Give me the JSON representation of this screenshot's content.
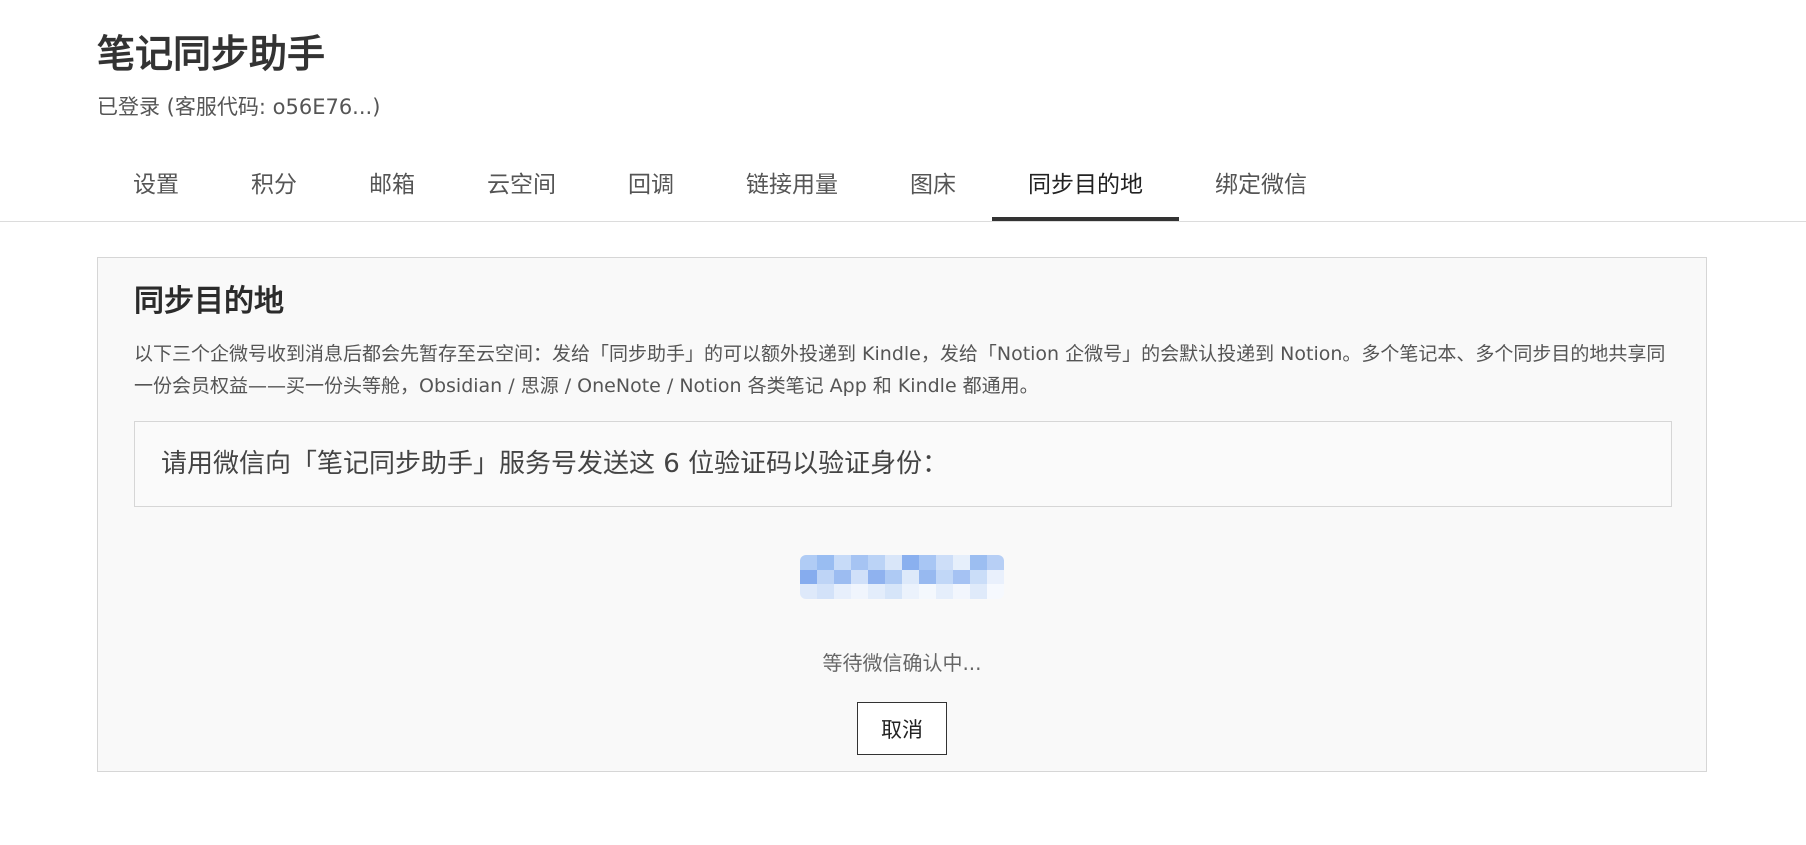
{
  "header": {
    "title": "笔记同步助手",
    "login_status": "已登录 (客服代码: o56E76...)"
  },
  "tabs": [
    {
      "label": "设置",
      "active": false
    },
    {
      "label": "积分",
      "active": false
    },
    {
      "label": "邮箱",
      "active": false
    },
    {
      "label": "云空间",
      "active": false
    },
    {
      "label": "回调",
      "active": false
    },
    {
      "label": "链接用量",
      "active": false
    },
    {
      "label": "图床",
      "active": false
    },
    {
      "label": "同步目的地",
      "active": true
    },
    {
      "label": "绑定微信",
      "active": false
    }
  ],
  "panel": {
    "title": "同步目的地",
    "description": "以下三个企微号收到消息后都会先暂存至云空间：发给「同步助手」的可以额外投递到 Kindle，发给「Notion 企微号」的会默认投递到 Notion。多个笔记本、多个同步目的地共享同一份会员权益——买一份头等舱，Obsidian / 思源 / OneNote / Notion 各类笔记 App 和 Kindle 都通用。",
    "instruction": "请用微信向「笔记同步助手」服务号发送这 6 位验证码以验证身份：",
    "waiting_text": "等待微信确认中...",
    "cancel_label": "取消"
  },
  "colors": {
    "accent": "#333333",
    "panel_background": "#f9f9f9",
    "border": "#d6d6d6",
    "blurred_code": "#8fb7f2"
  }
}
